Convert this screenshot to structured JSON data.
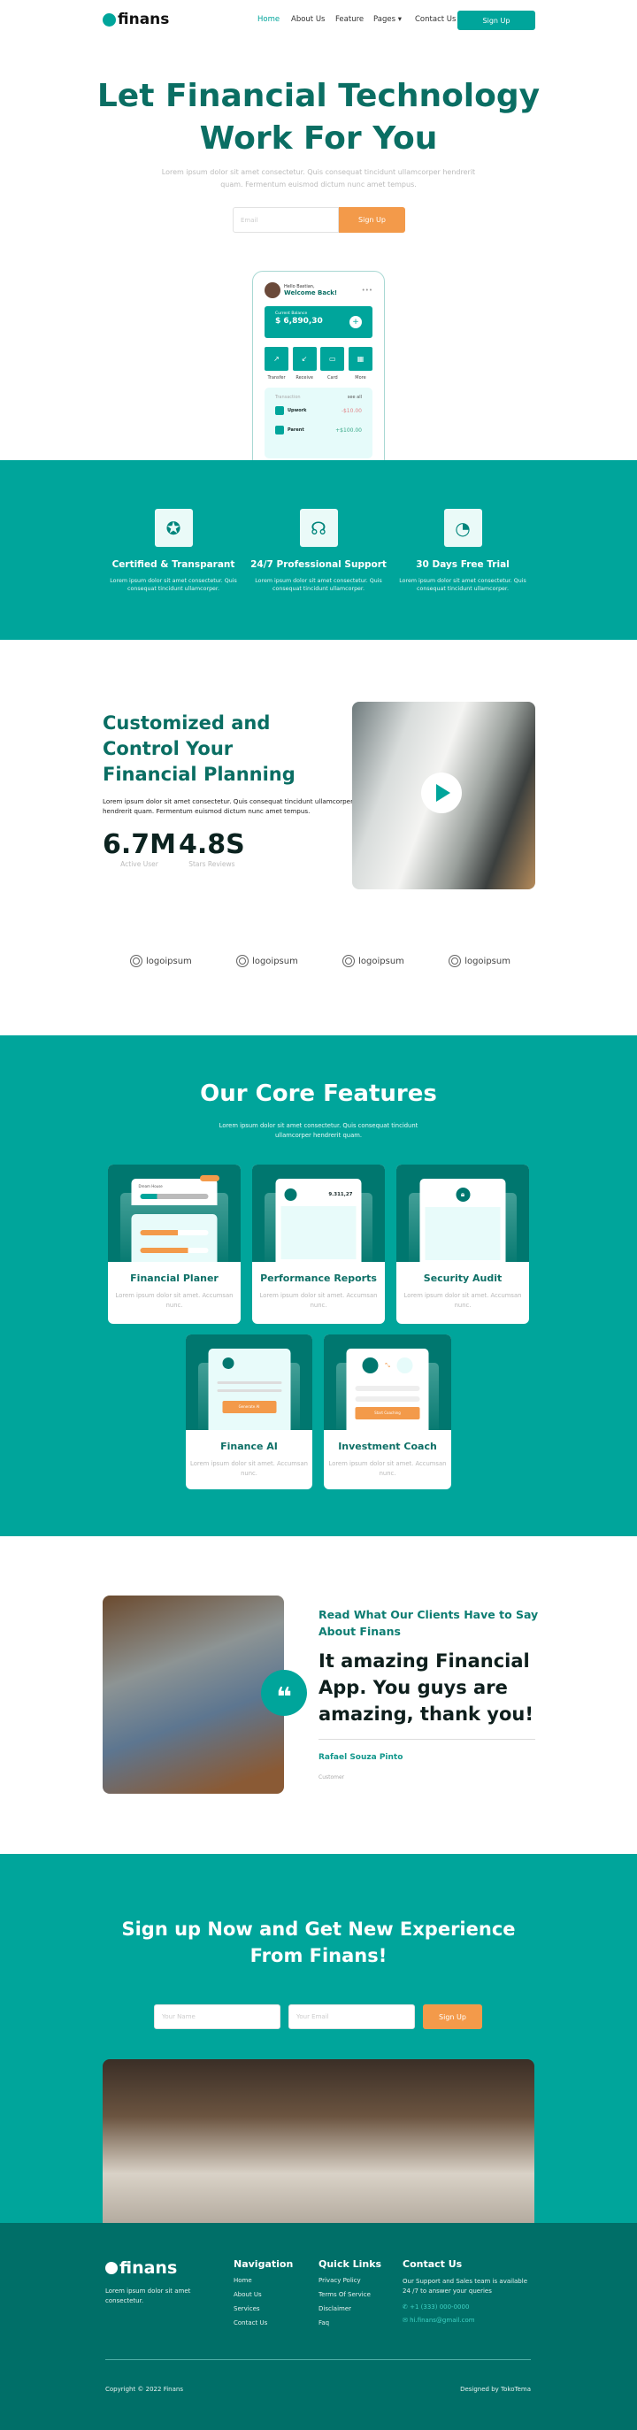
{
  "colors": {
    "primary": "#00a59b",
    "dark": "#006f68",
    "heading": "#0a6e63",
    "accent": "#f39a4a"
  },
  "nav": {
    "logo": "finans",
    "links": [
      "Home",
      "About Us",
      "Feature",
      "Pages",
      "Contact Us"
    ],
    "active": "Home",
    "signup": "Sign Up"
  },
  "hero": {
    "title_line1": "Let Financial Technology",
    "title_line2": "Work For You",
    "subtitle_line1": "Lorem ipsum dolor sit amet consectetur. Quis consequat tincidunt ullamcorper hendrerit",
    "subtitle_line2": "quam. Fermentum euismod dictum nunc amet tempus.",
    "email_placeholder": "Email",
    "signup": "Sign Up"
  },
  "phone": {
    "greeting": "Hello Bastian,",
    "welcome": "Welcome Back!",
    "balance_label": "Current Balance",
    "balance": "$ 6,890,30",
    "actions": [
      "Transfer",
      "Receive",
      "Card",
      "More"
    ],
    "transactions_title": "Transaction",
    "see_all": "see all",
    "transactions": [
      {
        "name": "Upwork",
        "amount": "-$10.00"
      },
      {
        "name": "Parent",
        "amount": "+$100.00"
      }
    ]
  },
  "benefits": [
    {
      "icon": "award-icon",
      "title": "Certified & Transparant",
      "desc": "Lorem ipsum dolor sit amet consectetur. Quis consequat tincidunt ullamcorper."
    },
    {
      "icon": "headset-icon",
      "title": "24/7 Professional Support",
      "desc": "Lorem ipsum dolor sit amet consectetur. Quis consequat tincidunt ullamcorper."
    },
    {
      "icon": "speedometer-icon",
      "title": "30 Days Free Trial",
      "desc": "Lorem ipsum dolor sit amet consectetur. Quis consequat tincidunt ullamcorper."
    }
  ],
  "about": {
    "title": "Customized and Control Your Financial Planning",
    "desc": "Lorem ipsum dolor sit amet consectetur. Quis consequat tincidunt ullamcorper hendrerit quam. Fermentum euismod dictum nunc amet tempus.",
    "stats": [
      {
        "value": "6.7M",
        "label": "Active User"
      },
      {
        "value": "4.8S",
        "label": "Stars Reviews"
      }
    ]
  },
  "logos": [
    "logoipsum",
    "logoipsum",
    "logoipsum",
    "logoipsum"
  ],
  "features": {
    "title": "Our Core Features",
    "desc": "Lorem ipsum dolor sit amet consectetur. Quis consequat tincidunt ullamcorper hendrerit quam.",
    "balance": "9.311,27",
    "generate": "Generate AI",
    "coaching": "Start Coaching",
    "items": [
      {
        "title": "Financial Planer",
        "desc": "Lorem ipsum dolor sit amet. Accumsan nunc."
      },
      {
        "title": "Performance Reports",
        "desc": "Lorem ipsum dolor sit amet. Accumsan nunc."
      },
      {
        "title": "Security Audit",
        "desc": "Lorem ipsum dolor sit amet. Accumsan nunc."
      },
      {
        "title": "Finance AI",
        "desc": "Lorem ipsum dolor sit amet. Accumsan nunc."
      },
      {
        "title": "Investment Coach",
        "desc": "Lorem ipsum dolor sit amet. Accumsan nunc."
      }
    ]
  },
  "testimonial": {
    "heading": "Read What Our Clients Have to Say About Finans",
    "quote": "It amazing Financial App. You guys are amazing, thank you!",
    "name": "Rafael Souza Pinto",
    "role": "Customer"
  },
  "cta": {
    "title_line1": "Sign up Now and Get New Experience",
    "title_line2": "From Finans!",
    "name_placeholder": "Your Name",
    "email_placeholder": "Your Email",
    "signup": "Sign Up"
  },
  "footer": {
    "logo": "finans",
    "desc": "Lorem ipsum dolor sit amet consectetur.",
    "nav_title": "Navigation",
    "nav": [
      "Home",
      "About Us",
      "Services",
      "Contact Us"
    ],
    "quick_title": "Quick Links",
    "quick": [
      "Privacy Policy",
      "Terms Of Service",
      "Disclaimer",
      "Faq"
    ],
    "contact_title": "Contact Us",
    "contact_desc": "Our Support and Sales team is available 24 /7 to answer your queries",
    "phone": "+1 (333) 000-0000",
    "email": "hi.finans@gmail.com",
    "copyright": "Copyright © 2022 Finans",
    "designed": "Designed by TokoTema"
  }
}
